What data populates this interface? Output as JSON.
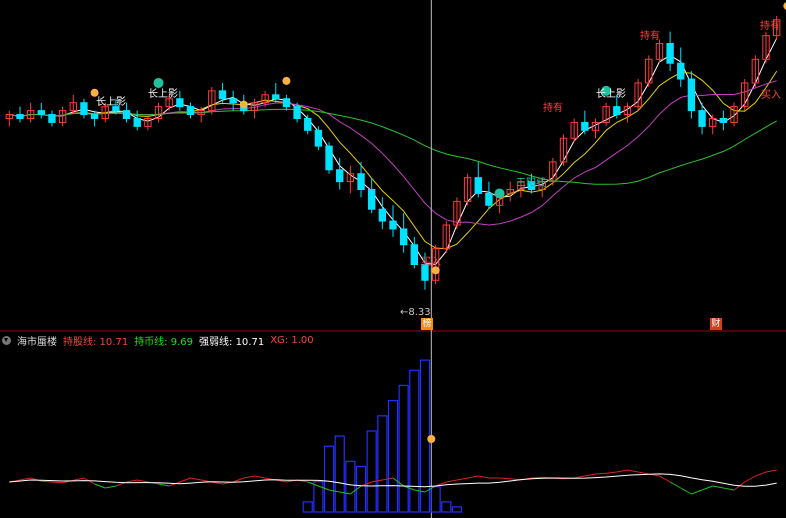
{
  "colors": {
    "background": "#000000",
    "up": "#ff3b3b",
    "down": "#00e0ff",
    "ma_short": "#ffffff",
    "ma_mid": "#e6d200",
    "ma_long": "#c040c0",
    "ma_trend": "#30c030",
    "cursor": "#c0c0c0",
    "divider": "#a00000",
    "bars": "#2030ff",
    "osc_red": "#e02020",
    "osc_green": "#20c020",
    "osc_white": "#ffffff",
    "signal_buy": "#ff4040",
    "signal_hold": "#ff4040",
    "signal_long": "#ffffff",
    "badge": "#ffb040",
    "check": "#20c0a0"
  },
  "indicator": {
    "name": "海市蜃楼",
    "hold_stock_label": "持股线: 10.71",
    "hold_cash_label": "持币线: 9.69",
    "strength_label": "强弱线: 10.71",
    "xg_label": "XG: 1.00"
  },
  "price_labels": {
    "low_price": "8.33"
  },
  "event_tags": {
    "tag1": "榜",
    "tag2": "财"
  },
  "annotations": [
    {
      "text": "长上影",
      "color": "#ffffff"
    },
    {
      "text": "长上影",
      "color": "#ffffff"
    },
    {
      "text": "持有",
      "color": "#ff4040"
    },
    {
      "text": "长上影",
      "color": "#ffffff"
    },
    {
      "text": "买入",
      "color": "#ff4040"
    },
    {
      "text": "买入",
      "color": "#ff4040"
    },
    {
      "text": "持有",
      "color": "#ff4040"
    },
    {
      "text": "持有",
      "color": "#ff4040"
    },
    {
      "text": "三阳线",
      "color": "#20c0a0"
    }
  ],
  "chart_data": [
    {
      "type": "candlestick",
      "title": "",
      "series": [
        {
          "name": "",
          "kind": "ohlc",
          "values": [
            [
              10.5,
              10.6,
              10.4,
              10.55
            ],
            [
              10.55,
              10.65,
              10.45,
              10.5
            ],
            [
              10.5,
              10.7,
              10.45,
              10.6
            ],
            [
              10.6,
              10.7,
              10.5,
              10.55
            ],
            [
              10.55,
              10.6,
              10.4,
              10.45
            ],
            [
              10.45,
              10.65,
              10.4,
              10.6
            ],
            [
              10.6,
              10.8,
              10.55,
              10.7
            ],
            [
              10.7,
              10.75,
              10.5,
              10.55
            ],
            [
              10.55,
              10.6,
              10.4,
              10.5
            ],
            [
              10.5,
              10.7,
              10.45,
              10.65
            ],
            [
              10.65,
              10.75,
              10.55,
              10.6
            ],
            [
              10.6,
              10.7,
              10.45,
              10.5
            ],
            [
              10.5,
              10.6,
              10.35,
              10.4
            ],
            [
              10.4,
              10.55,
              10.35,
              10.5
            ],
            [
              10.5,
              10.7,
              10.45,
              10.65
            ],
            [
              10.65,
              10.8,
              10.6,
              10.75
            ],
            [
              10.75,
              10.85,
              10.6,
              10.65
            ],
            [
              10.65,
              10.7,
              10.5,
              10.55
            ],
            [
              10.55,
              10.65,
              10.45,
              10.6
            ],
            [
              10.6,
              10.9,
              10.55,
              10.85
            ],
            [
              10.85,
              10.95,
              10.7,
              10.75
            ],
            [
              10.75,
              10.85,
              10.6,
              10.7
            ],
            [
              10.7,
              10.8,
              10.55,
              10.6
            ],
            [
              10.6,
              10.75,
              10.5,
              10.7
            ],
            [
              10.7,
              10.85,
              10.65,
              10.8
            ],
            [
              10.8,
              10.95,
              10.7,
              10.75
            ],
            [
              10.75,
              10.8,
              10.6,
              10.65
            ],
            [
              10.65,
              10.7,
              10.45,
              10.5
            ],
            [
              10.5,
              10.55,
              10.3,
              10.35
            ],
            [
              10.35,
              10.4,
              10.1,
              10.15
            ],
            [
              10.15,
              10.2,
              9.8,
              9.85
            ],
            [
              9.85,
              10.0,
              9.6,
              9.7
            ],
            [
              9.7,
              9.9,
              9.55,
              9.8
            ],
            [
              9.8,
              9.95,
              9.5,
              9.6
            ],
            [
              9.6,
              9.75,
              9.3,
              9.35
            ],
            [
              9.35,
              9.5,
              9.1,
              9.2
            ],
            [
              9.2,
              9.4,
              9.0,
              9.1
            ],
            [
              9.1,
              9.3,
              8.8,
              8.9
            ],
            [
              8.9,
              9.0,
              8.6,
              8.65
            ],
            [
              8.65,
              8.8,
              8.33,
              8.45
            ],
            [
              8.45,
              8.9,
              8.4,
              8.85
            ],
            [
              8.85,
              9.2,
              8.8,
              9.15
            ],
            [
              9.15,
              9.5,
              9.1,
              9.45
            ],
            [
              9.45,
              9.8,
              9.4,
              9.75
            ],
            [
              9.75,
              9.95,
              9.5,
              9.55
            ],
            [
              9.55,
              9.7,
              9.35,
              9.4
            ],
            [
              9.4,
              9.6,
              9.3,
              9.55
            ],
            [
              9.55,
              9.7,
              9.45,
              9.6
            ],
            [
              9.6,
              9.75,
              9.5,
              9.7
            ],
            [
              9.7,
              9.8,
              9.55,
              9.6
            ],
            [
              9.6,
              9.75,
              9.5,
              9.7
            ],
            [
              9.7,
              10.0,
              9.65,
              9.95
            ],
            [
              9.95,
              10.3,
              9.9,
              10.25
            ],
            [
              10.25,
              10.5,
              10.2,
              10.45
            ],
            [
              10.45,
              10.6,
              10.3,
              10.35
            ],
            [
              10.35,
              10.5,
              10.25,
              10.45
            ],
            [
              10.45,
              10.7,
              10.4,
              10.65
            ],
            [
              10.65,
              10.8,
              10.5,
              10.55
            ],
            [
              10.55,
              10.7,
              10.45,
              10.65
            ],
            [
              10.65,
              11.0,
              10.6,
              10.95
            ],
            [
              10.95,
              11.3,
              10.9,
              11.25
            ],
            [
              11.25,
              11.5,
              11.2,
              11.45
            ],
            [
              11.45,
              11.6,
              11.1,
              11.2
            ],
            [
              11.2,
              11.4,
              10.9,
              11.0
            ],
            [
              11.0,
              11.1,
              10.5,
              10.6
            ],
            [
              10.6,
              10.7,
              10.3,
              10.4
            ],
            [
              10.4,
              10.55,
              10.3,
              10.5
            ],
            [
              10.5,
              10.6,
              10.35,
              10.45
            ],
            [
              10.45,
              10.7,
              10.4,
              10.65
            ],
            [
              10.65,
              11.0,
              10.6,
              10.95
            ],
            [
              10.95,
              11.3,
              10.9,
              11.25
            ],
            [
              11.25,
              11.6,
              11.2,
              11.55
            ],
            [
              11.55,
              11.8,
              11.5,
              11.75
            ]
          ]
        },
        {
          "name": "",
          "kind": "ma_short",
          "values": []
        },
        {
          "name": "",
          "kind": "ma_mid",
          "values": []
        },
        {
          "name": "",
          "kind": "ma_long",
          "values": []
        },
        {
          "name": "",
          "kind": "ma_trend",
          "values": []
        }
      ],
      "ylim": [
        8.2,
        11.9
      ],
      "annotations_ref": "annotations",
      "low_marker": 8.33
    },
    {
      "type": "bar",
      "title": "",
      "series": [
        {
          "name": "",
          "values": [
            0,
            0,
            0,
            0,
            0,
            0,
            0,
            0,
            0,
            0,
            0,
            0,
            0,
            0,
            0,
            0,
            0,
            0,
            0,
            0,
            0,
            0,
            0,
            0,
            0,
            0,
            0,
            0,
            0.2,
            0.6,
            1.3,
            1.5,
            1.0,
            0.9,
            1.6,
            1.9,
            2.2,
            2.5,
            2.8,
            3.0,
            0.5,
            0.2,
            0.1,
            0,
            0,
            0,
            0,
            0,
            0,
            0,
            0,
            0,
            0,
            0,
            0,
            0,
            0,
            0,
            0,
            0,
            0,
            0,
            0,
            0,
            0,
            0,
            0,
            0,
            0,
            0,
            0,
            0,
            0
          ]
        }
      ],
      "ylim": [
        0,
        3.2
      ],
      "oscillator": {
        "name": "",
        "values": [
          0.2,
          0.25,
          0.3,
          0.22,
          0.2,
          0.18,
          0.24,
          0.3,
          0.15,
          0.05,
          0.1,
          0.2,
          0.25,
          0.2,
          0.15,
          0.1,
          0.2,
          0.3,
          0.25,
          0.2,
          0.15,
          0.2,
          0.3,
          0.35,
          0.3,
          0.25,
          0.2,
          0.25,
          0.2,
          0.1,
          0.0,
          -0.05,
          -0.1,
          0.1,
          0.2,
          0.25,
          0.3,
          0.1,
          0.0,
          -0.05,
          0.1,
          0.2,
          0.25,
          0.3,
          0.35,
          0.3,
          0.3,
          0.28,
          0.25,
          0.3,
          0.32,
          0.3,
          0.28,
          0.3,
          0.35,
          0.4,
          0.42,
          0.45,
          0.5,
          0.45,
          0.4,
          0.35,
          0.2,
          0.05,
          -0.1,
          0.0,
          0.1,
          0.05,
          0.0,
          0.2,
          0.35,
          0.45,
          0.5
        ]
      },
      "baseline": {
        "name": "",
        "values": []
      }
    }
  ]
}
